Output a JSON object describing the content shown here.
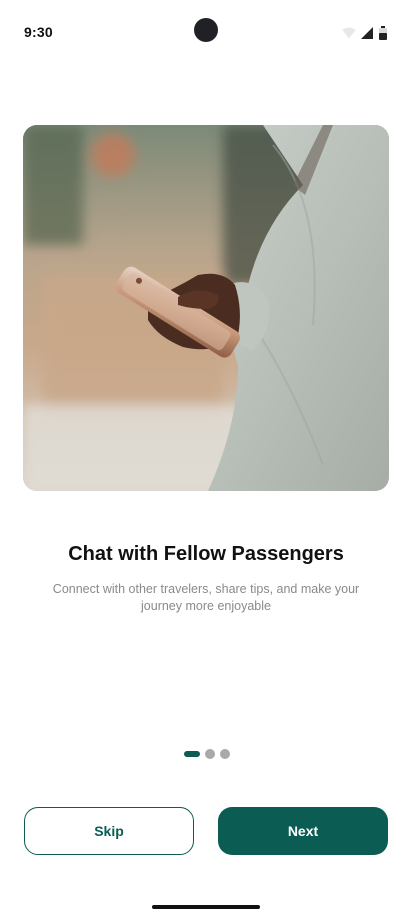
{
  "status_bar": {
    "time": "9:30",
    "icons": [
      "wifi-icon",
      "signal-icon",
      "battery-icon"
    ]
  },
  "hero_image": {
    "subject": "person-holding-smartphone"
  },
  "onboarding": {
    "title": "Chat with Fellow Passengers",
    "subtitle": "Connect with other travelers, share tips, and make your journey more enjoyable",
    "pagination": {
      "total": 3,
      "active": 1
    }
  },
  "actions": {
    "skip_label": "Skip",
    "next_label": "Next"
  },
  "colors": {
    "primary": "#0b5c52",
    "title_text": "#111111",
    "subtitle_text": "#8a8a8a",
    "inactive_dot": "#a9a9a9"
  }
}
